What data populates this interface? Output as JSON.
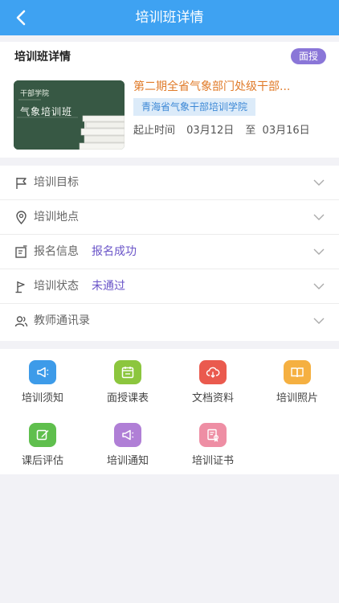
{
  "header": {
    "title": "培训班详情",
    "back_icon": "chevron-left-icon"
  },
  "detail": {
    "section_title": "培训班详情",
    "badge": "面授",
    "cover_text_top": "干部学院",
    "cover_text_main": "气象培训班",
    "course_name": "第二期全省气象部门处级干部...",
    "organizer": "青海省气象干部培训学院",
    "date_label": "起止时间",
    "start_date": "03月12日",
    "date_sep": "至",
    "end_date": "03月16日"
  },
  "menu": {
    "items": [
      {
        "label": "培训目标",
        "value": "",
        "icon": "flag-icon"
      },
      {
        "label": "培训地点",
        "value": "",
        "icon": "location-pin-icon"
      },
      {
        "label": "报名信息",
        "value": "报名成功",
        "icon": "edit-note-icon"
      },
      {
        "label": "培训状态",
        "value": "未通过",
        "icon": "status-flag-icon"
      },
      {
        "label": "教师通讯录",
        "value": "",
        "icon": "contacts-icon"
      }
    ]
  },
  "features": {
    "items": [
      {
        "label": "培训须知",
        "icon": "megaphone-icon",
        "color": "#3d9be9"
      },
      {
        "label": "面授课表",
        "icon": "calendar-icon",
        "color": "#8cc63e"
      },
      {
        "label": "文档资料",
        "icon": "cloud-download-icon",
        "color": "#ea5a4e"
      },
      {
        "label": "培训照片",
        "icon": "book-icon",
        "color": "#f5b041"
      },
      {
        "label": "课后评估",
        "icon": "edit-icon",
        "color": "#5fbf4d"
      },
      {
        "label": "培训通知",
        "icon": "megaphone-icon",
        "color": "#b07fd6"
      },
      {
        "label": "培训证书",
        "icon": "certificate-icon",
        "color": "#ee8ea4"
      }
    ]
  },
  "colors": {
    "header_bg": "#3ea2f2",
    "badge_bg": "#8a76d8",
    "course_name": "#e07b2a",
    "status_value": "#6a54c8"
  }
}
